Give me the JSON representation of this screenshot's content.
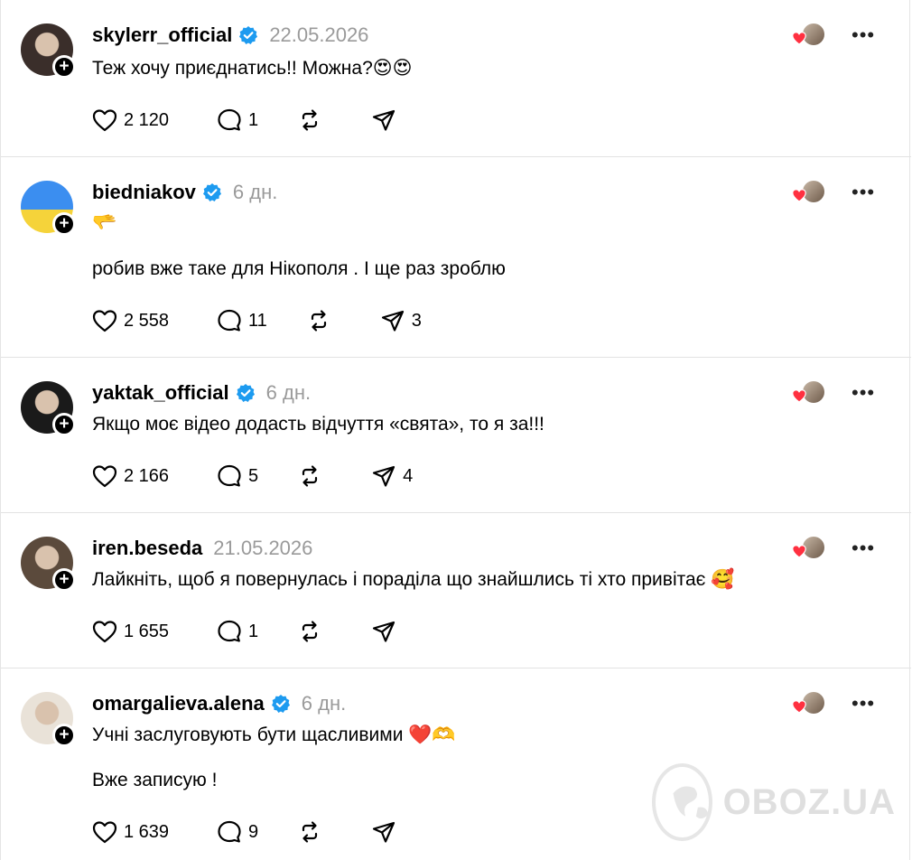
{
  "comments": [
    {
      "username": "skylerr_official",
      "verified": true,
      "time": "22.05.2026",
      "lines": [
        "Теж хочу приєднатись!! Можна?😍😍"
      ],
      "likes": "2 120",
      "replies": "1",
      "shares": "",
      "avatar_color": "#3a2e2a"
    },
    {
      "username": "biedniakov",
      "verified": true,
      "time": "6 дн.",
      "lines": [
        "🫳",
        "робив вже таке для Нікополя . І ще раз зроблю"
      ],
      "likes": "2 558",
      "replies": "11",
      "shares": "3",
      "avatar_color": "#2f6fd0"
    },
    {
      "username": "yaktak_official",
      "verified": true,
      "time": "6 дн.",
      "lines": [
        "Якщо моє відео додасть відчуття «свята», то я за!!!"
      ],
      "likes": "2 166",
      "replies": "5",
      "shares": "4",
      "avatar_color": "#1a1a1a"
    },
    {
      "username": "iren.beseda",
      "verified": false,
      "time": "21.05.2026",
      "lines": [
        "Лайкніть, щоб я повернулась і пораділа що знайшлись ті хто привітає 🥰"
      ],
      "likes": "1 655",
      "replies": "1",
      "shares": "",
      "avatar_color": "#5b4a3c"
    },
    {
      "username": "omargalieva.alena",
      "verified": true,
      "time": "6 дн.",
      "lines": [
        "Учні заслуговують бути щасливими ❤️🫶",
        "Вже записую !"
      ],
      "likes": "1 639",
      "replies": "9",
      "shares": "",
      "avatar_color": "#e9e2d8"
    }
  ],
  "follow_symbol": "+",
  "more_symbol": "•••",
  "watermark": "OBOZ.UA",
  "colors": {
    "verified": "#1d9bf0",
    "heart": "#ff3040",
    "muted": "#9a9a9a"
  },
  "icons": [
    "heart-icon",
    "comment-icon",
    "repost-icon",
    "share-icon",
    "verified-badge-icon",
    "more-icon"
  ]
}
